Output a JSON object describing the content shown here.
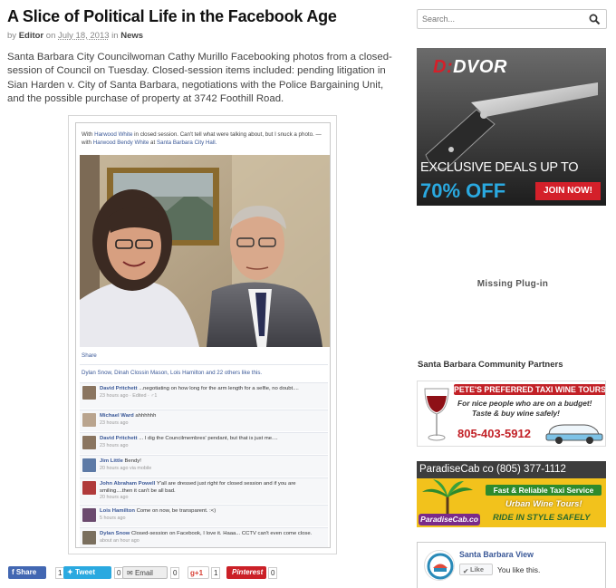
{
  "post": {
    "title": "A Slice of Political Life in the Facebook Age",
    "by_prefix": "by",
    "author": "Editor",
    "on_word": "on",
    "date": "July 18, 2013",
    "in_word": "in",
    "category": "News",
    "body": "Santa Barbara City Councilwoman Cathy Murillo Facebooking photos from a closed-session of Council on Tuesday. Closed-session items included: pending litigation in Sian Harden v. City of Santa Barbara, negotiations with the Police Bargaining Unit, and the possible purchase of property at 3742 Foothill Road."
  },
  "fb_post": {
    "caption_pre": "With",
    "caption_tag": "Harwood White",
    "caption_text": "in closed session. Can't tell what were talking about, but I snuck a photo. —",
    "caption_with": "with",
    "caption_tag2": "Harwood Bendy White",
    "caption_at": "at",
    "caption_place": "Santa Barbara City Hall.",
    "share": "Share",
    "likes": "Dylan Snow, Dinah Clossin Mason, Lois Hamilton and 22 others like this.",
    "comments": [
      {
        "name": "David Pritchett",
        "text": "...negotiating on how long for the arm length for a selfie, no doubt....",
        "meta": "23 hours ago · Edited · ♂1",
        "avatar": "#8a7560",
        "tall": true
      },
      {
        "name": "Michael Ward",
        "text": "ahhhhhh",
        "meta": "23 hours ago",
        "avatar": "#b9a48e",
        "tall": false
      },
      {
        "name": "David Pritchett",
        "text": "... I dig the Councilmembres' pendant, but that is just me....",
        "meta": "23 hours ago",
        "avatar": "#8a7560",
        "tall": false
      },
      {
        "name": "Jim Little",
        "text": "Bendy!",
        "meta": "20 hours ago via mobile",
        "avatar": "#5d7aa6",
        "tall": false
      },
      {
        "name": "John Abraham Powell",
        "text": "Y'all are dressed just right for closed session and if you are smiling....then it can't be all bad.",
        "meta": "20 hours ago",
        "avatar": "#b03a3a",
        "tall": true
      },
      {
        "name": "Lois Hamilton",
        "text": "Come on now, be transparent. :<)",
        "meta": "5 hours ago",
        "avatar": "#6b4a6e",
        "tall": false
      },
      {
        "name": "Dylan Snow",
        "text": "Closed-session on Facebook, I love it. Haaa... CCTV can't even come close.",
        "meta": "about an hour ago",
        "avatar": "#7a6f5e",
        "tall": true
      }
    ]
  },
  "share_bar": {
    "facebook_label": "Share",
    "facebook_count": "1",
    "tweet_label": "Tweet",
    "tweet_count": "0",
    "email_label": "Email",
    "email_count": "0",
    "gplus_label": "+1",
    "gplus_count": "1",
    "pinterest_label": "Pinterest",
    "pinterest_count": "0"
  },
  "sidebar": {
    "search_placeholder": "Search...",
    "ad_dvor": {
      "brand": "DVOR",
      "line1": "EXCLUSIVE DEALS UP TO",
      "pct": "70% OFF",
      "cta": "JOIN NOW!"
    },
    "missing_plugin": "Missing Plug-in",
    "partners_heading": "Santa Barbara Community Partners",
    "ad_taxi": {
      "title": "PETE'S PREFERRED TAXI WINE TOURS",
      "line1": "For nice people who are on a budget!",
      "line2": "Taste & buy wine safely!",
      "phone": "805-403-5912"
    },
    "ad_cab": {
      "header": "ParadiseCab co (805) 377-1112",
      "line1": "Fast & Reliable Taxi Service",
      "line2": "Urban Wine Tours!",
      "line3": "RIDE IN STYLE SAFELY",
      "logo": "ParadiseCab.co"
    },
    "fb_page": {
      "name": "Santa Barbara View",
      "like": "Like",
      "you_like": "You like this."
    }
  },
  "colors": {
    "facebook": "#3b5998",
    "twitter": "#2aa9e0",
    "pinterest": "#cb2027",
    "dvor_red": "#d4202a",
    "cab_green": "#2d8a2d"
  }
}
